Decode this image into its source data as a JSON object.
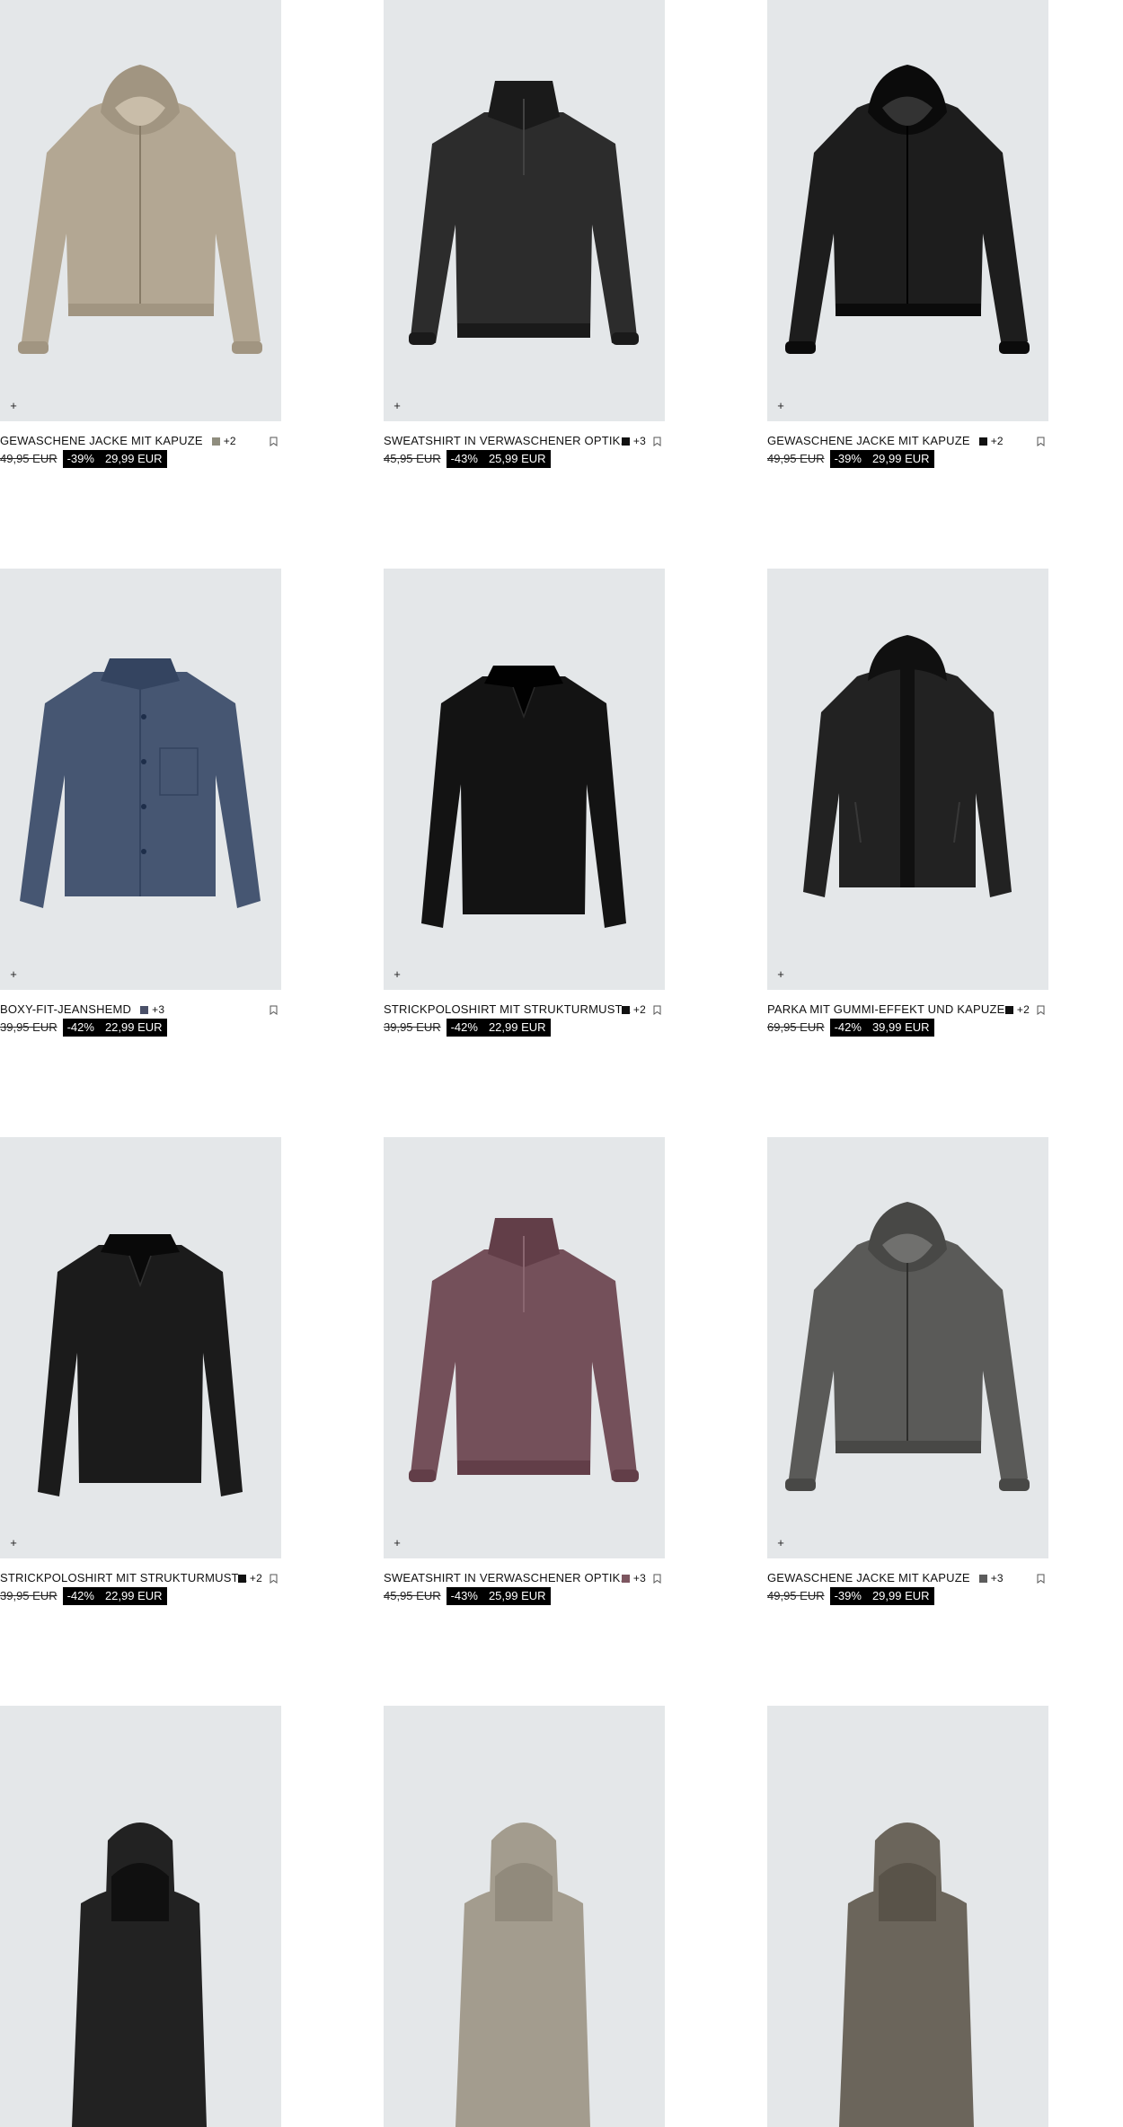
{
  "products": [
    {
      "name": "GEWASCHENE JACKE MIT KAPUZE",
      "more": "+2",
      "swatch": "#8f8d7e",
      "old_price": "49,95 EUR",
      "discount": "-39%",
      "price": "29,99 EUR",
      "art": "jacket",
      "color": "#b3a793",
      "has_bookmark": true
    },
    {
      "name": "SWEATSHIRT IN VERWASCHENER OPTIK...",
      "more": "+3",
      "swatch": "#111111",
      "old_price": "45,95 EUR",
      "discount": "-43%",
      "price": "25,99 EUR",
      "art": "sweat",
      "color": "#2c2c2c",
      "has_bookmark": true
    },
    {
      "name": "GEWASCHENE JACKE MIT KAPUZE",
      "more": "+2",
      "swatch": "#111111",
      "old_price": "49,95 EUR",
      "discount": "-39%",
      "price": "29,99 EUR",
      "art": "jacket",
      "color": "#1d1d1d",
      "has_bookmark": true
    },
    {
      "name": "BOXY-FIT-JEANSHEMD",
      "more": "+3",
      "swatch": "#4a5068",
      "old_price": "39,95 EUR",
      "discount": "-42%",
      "price": "22,99 EUR",
      "art": "shirt",
      "color": "#465672",
      "has_bookmark": true
    },
    {
      "name": "STRICKPOLOSHIRT MIT STRUKTURMUST...",
      "more": "+2",
      "swatch": "#111111",
      "old_price": "39,95 EUR",
      "discount": "-42%",
      "price": "22,99 EUR",
      "art": "polo",
      "color": "#131313",
      "has_bookmark": true
    },
    {
      "name": "PARKA MIT GUMMI-EFFEKT UND KAPUZE",
      "more": "+2",
      "swatch": "#111111",
      "old_price": "69,95 EUR",
      "discount": "-42%",
      "price": "39,99 EUR",
      "art": "parka",
      "color": "#222222",
      "has_bookmark": true
    },
    {
      "name": "STRICKPOLOSHIRT MIT STRUKTURMUST...",
      "more": "+2",
      "swatch": "#111111",
      "old_price": "39,95 EUR",
      "discount": "-42%",
      "price": "22,99 EUR",
      "art": "polo",
      "color": "#1b1b1b",
      "has_bookmark": true
    },
    {
      "name": "SWEATSHIRT IN VERWASCHENER OPTIK...",
      "more": "+3",
      "swatch": "#7d5660",
      "old_price": "45,95 EUR",
      "discount": "-43%",
      "price": "25,99 EUR",
      "art": "sweat",
      "color": "#74505a",
      "has_bookmark": true
    },
    {
      "name": "GEWASCHENE JACKE MIT KAPUZE",
      "more": "+3",
      "swatch": "#5c5c5c",
      "old_price": "49,95 EUR",
      "discount": "-39%",
      "price": "29,99 EUR",
      "art": "jacket",
      "color": "#5a5a58",
      "has_bookmark": true
    },
    {
      "art": "hood_partial",
      "color": "#222222"
    },
    {
      "art": "hood_partial",
      "color": "#a39c8e"
    },
    {
      "art": "hood_partial",
      "color": "#6b655b"
    }
  ],
  "add_icon_label": "+"
}
